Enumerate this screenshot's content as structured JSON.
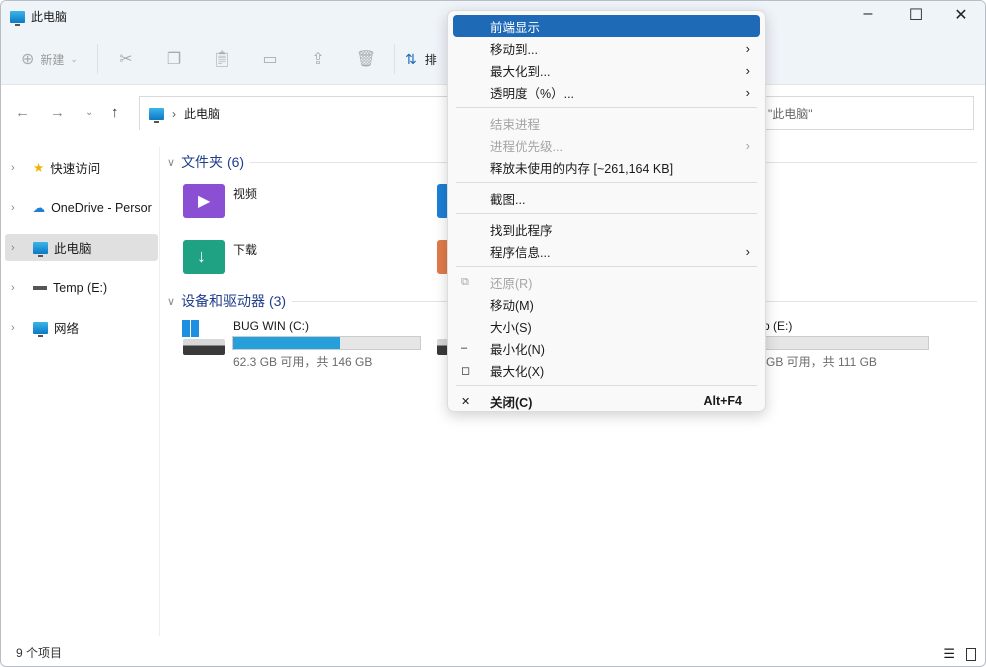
{
  "window": {
    "title": "此电脑",
    "minimize": "–",
    "maximize": "☐",
    "close": "✕"
  },
  "toolbar": {
    "new_label": "新建",
    "sort_label": "排"
  },
  "address": {
    "crumb": "此电脑",
    "search_placeholder": "\"此电脑\""
  },
  "sidebar": {
    "items": [
      {
        "label": "快速访问",
        "icon": "star-icon"
      },
      {
        "label": "OneDrive - Persor",
        "icon": "cloud-icon"
      },
      {
        "label": "此电脑",
        "icon": "pc-icon",
        "selected": true
      },
      {
        "label": "Temp (E:)",
        "icon": "drive-icon"
      },
      {
        "label": "网络",
        "icon": "network-icon"
      }
    ]
  },
  "folders": {
    "header": "文件夹 (6)",
    "items": [
      {
        "label": "视频",
        "color": "#8b4fd3"
      },
      {
        "label": "下载",
        "color": "#1fa184"
      }
    ]
  },
  "drives": {
    "header": "设备和驱动器 (3)",
    "items": [
      {
        "name": "BUG WIN (C:)",
        "sub": "62.3 GB 可用，共 146 GB",
        "used_fraction": 0.57
      },
      {
        "name": "p (E:)",
        "sub": "GB 可用，共 111 GB",
        "used_fraction": 0
      }
    ]
  },
  "status": {
    "count": "9 个项目"
  },
  "menu": {
    "items": [
      {
        "label": "前端显示",
        "highlight": true
      },
      {
        "label": "移动到...",
        "submenu": true
      },
      {
        "label": "最大化到...",
        "submenu": true
      },
      {
        "label": "透明度（%）...",
        "submenu": true
      },
      {
        "sep": true
      },
      {
        "label": "结束进程",
        "disabled": true
      },
      {
        "label": "进程优先级...",
        "disabled": true,
        "submenu": true
      },
      {
        "label": "释放未使用的内存 [~261,164 KB]"
      },
      {
        "sep": true
      },
      {
        "label": "截图..."
      },
      {
        "sep": true
      },
      {
        "label": "找到此程序"
      },
      {
        "label": "程序信息...",
        "submenu": true
      },
      {
        "sep": true
      },
      {
        "label": "还原(R)",
        "disabled": true,
        "icon": "restore-icon"
      },
      {
        "label": "移动(M)"
      },
      {
        "label": "大小(S)"
      },
      {
        "label": "最小化(N)",
        "icon": "minimize-icon"
      },
      {
        "label": "最大化(X)",
        "icon": "maximize-icon"
      },
      {
        "sep": true
      },
      {
        "label": "关闭(C)",
        "icon": "close-icon",
        "shortcut": "Alt+F4",
        "bold": true
      }
    ]
  },
  "colors": {
    "accent": "#1f6ab7",
    "drive_bar": "#26a0da"
  }
}
